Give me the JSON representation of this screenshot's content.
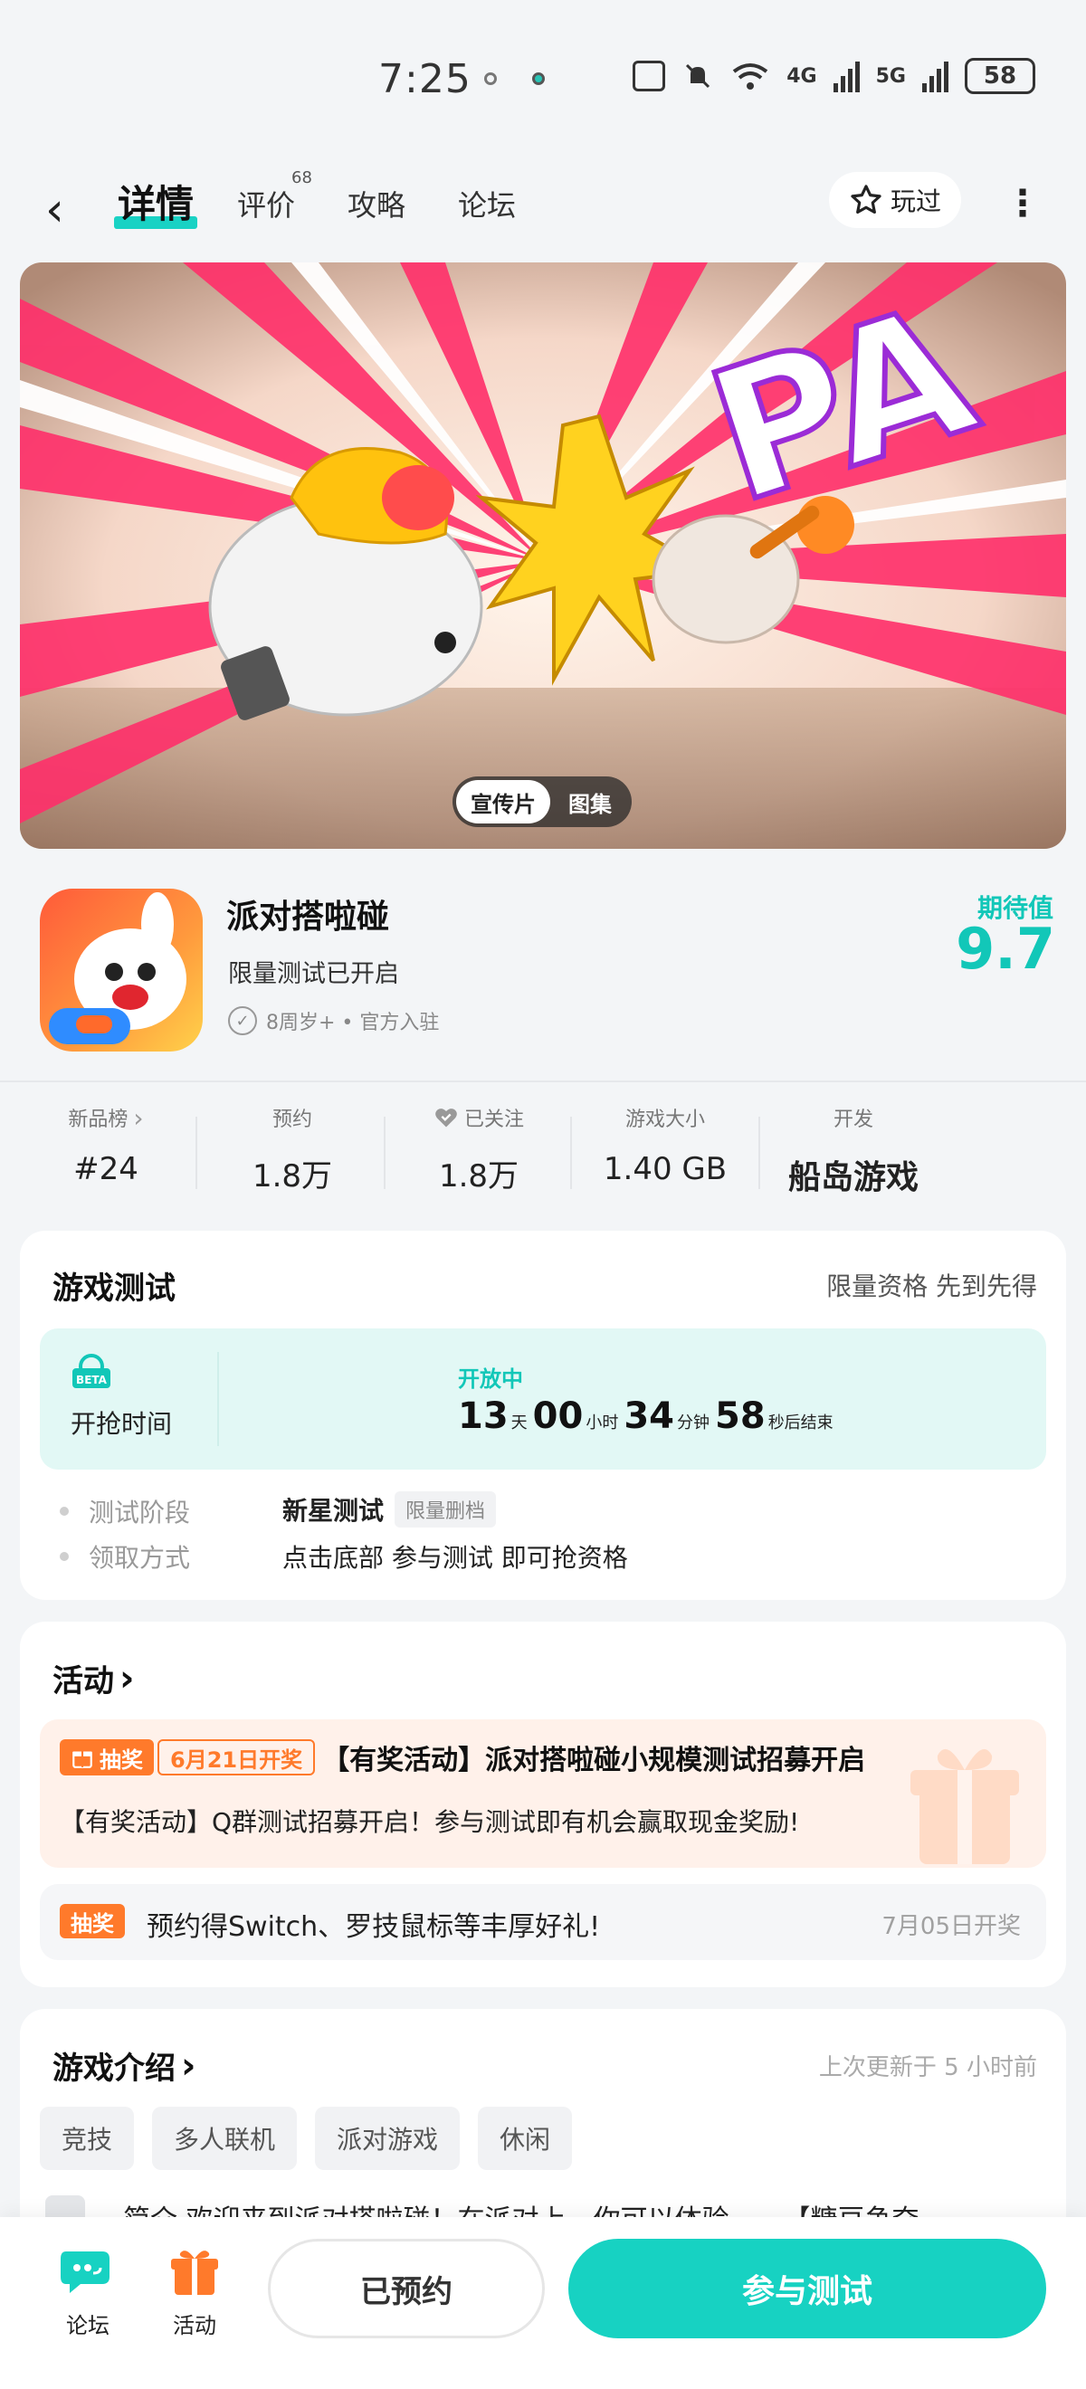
{
  "status_bar": {
    "time": "7:25",
    "network_4g": "4G",
    "network_5g": "5G",
    "battery": "58"
  },
  "nav": {
    "tabs": [
      {
        "label": "详情"
      },
      {
        "label": "评价",
        "badge": "68"
      },
      {
        "label": "攻略"
      },
      {
        "label": "论坛"
      }
    ],
    "played_label": "玩过"
  },
  "banner": {
    "toggle": [
      "宣传片",
      "图集"
    ],
    "art_text": "PA"
  },
  "game": {
    "name": "派对搭啦碰",
    "subtitle": "限量测试已开启",
    "meta": "8周岁+ • 官方入驻",
    "expectation_label": "期待值",
    "expectation_value": "9.7"
  },
  "stats": [
    {
      "label": "新品榜",
      "value": "#24"
    },
    {
      "label": "预约",
      "value": "1.8万"
    },
    {
      "label": "已关注",
      "value": "1.8万"
    },
    {
      "label": "游戏大小",
      "value": "1.40 GB"
    },
    {
      "label": "开发",
      "value": "船岛游戏"
    }
  ],
  "game_test": {
    "title": "游戏测试",
    "right_text": "限量资格 先到先得",
    "beta_icon_text": "BETA",
    "open_time_label": "开抢时间",
    "status": "开放中",
    "countdown": {
      "days": "13",
      "days_unit": "天",
      "hours": "00",
      "hours_unit": "小时",
      "minutes": "34",
      "minutes_unit": "分钟",
      "seconds": "58",
      "seconds_unit": "秒后结束"
    },
    "rows": [
      {
        "label": "测试阶段",
        "value": "新星测试",
        "tag": "限量删档"
      },
      {
        "label": "领取方式",
        "value": "点击底部 参与测试 即可抢资格"
      }
    ]
  },
  "activities": {
    "title": "活动",
    "items": [
      {
        "tag": "抽奖",
        "date_tag": "6月21日开奖",
        "title": "【有奖活动】派对搭啦碰小规模测试招募开启",
        "desc": "【有奖活动】Q群测试招募开启！参与测试即有机会赢取现金奖励!"
      },
      {
        "tag": "抽奖",
        "title": "预约得Switch、罗技鼠标等丰厚好礼!",
        "date": "7月05日开奖"
      }
    ]
  },
  "intro": {
    "title": "游戏介绍",
    "updated": "上次更新于 5 小时前",
    "tags": [
      "竞技",
      "多人联机",
      "派对游戏",
      "休闲"
    ],
    "preview": "简介 欢迎来到派对搭啦碰！在派对上，你可以体验——【糖豆争夺"
  },
  "bottom_bar": {
    "forum_label": "论坛",
    "activity_label": "活动",
    "reserved_label": "已预约",
    "join_label": "参与测试"
  },
  "colors": {
    "accent": "#17d2c2",
    "orange": "#ff7a2b",
    "text_secondary": "#999999"
  }
}
